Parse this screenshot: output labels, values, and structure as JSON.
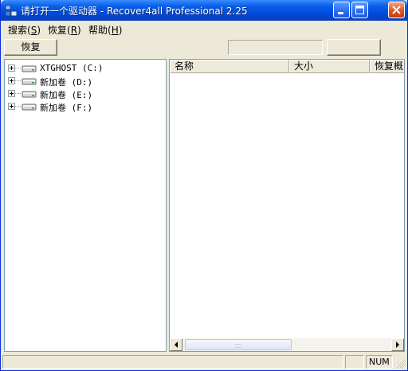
{
  "window": {
    "title": "请打开一个驱动器 - Recover4all Professional 2.25"
  },
  "menu": [
    {
      "label": "搜索",
      "key": "S"
    },
    {
      "label": "恢复",
      "key": "R"
    },
    {
      "label": "帮助",
      "key": "H"
    }
  ],
  "toolbar": {
    "restore_label": "恢复"
  },
  "drives": [
    {
      "label": "XTGHOST (C:)"
    },
    {
      "label": "新加卷 (D:)"
    },
    {
      "label": "新加卷 (E:)"
    },
    {
      "label": "新加卷 (F:)"
    }
  ],
  "list": {
    "columns": [
      "名称",
      "大小",
      "恢复概"
    ]
  },
  "statusbar": {
    "num": "NUM"
  },
  "colors": {
    "title_bar": "#0a5ee6",
    "accent_border": "#7f9db9"
  }
}
